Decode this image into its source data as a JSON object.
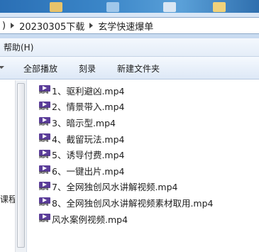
{
  "address_bar": {
    "crumbs": [
      "20230305下载",
      "玄学快速爆单"
    ]
  },
  "menu": {
    "help": "帮助(H)"
  },
  "toolbar": {
    "play_all": "全部播放",
    "burn": "刻录",
    "new_folder": "新建文件夹"
  },
  "nav_pane": {
    "label": "课程"
  },
  "files": [
    {
      "name": "1、驱利避凶.mp4",
      "icon": "mp4-video-icon"
    },
    {
      "name": "2、情景带入.mp4",
      "icon": "mp4-video-icon"
    },
    {
      "name": "3、暗示型.mp4",
      "icon": "mp4-video-icon"
    },
    {
      "name": "4、截留玩法.mp4",
      "icon": "mp4-video-icon"
    },
    {
      "name": "5、诱导付费.mp4",
      "icon": "mp4-video-icon"
    },
    {
      "name": "6、一键出片.mp4",
      "icon": "mp4-video-icon"
    },
    {
      "name": "7、全网独创风水讲解视频.mp4",
      "icon": "mp4-video-icon"
    },
    {
      "name": "8、全网独创风水讲解视频素材取用.mp4",
      "icon": "mp4-video-icon"
    },
    {
      "name": "风水案例视频.mp4",
      "icon": "mp4-video-icon"
    }
  ],
  "colors": {
    "icon_purple": "#5b3d99",
    "toolbar_blue": "#dde8f6"
  }
}
